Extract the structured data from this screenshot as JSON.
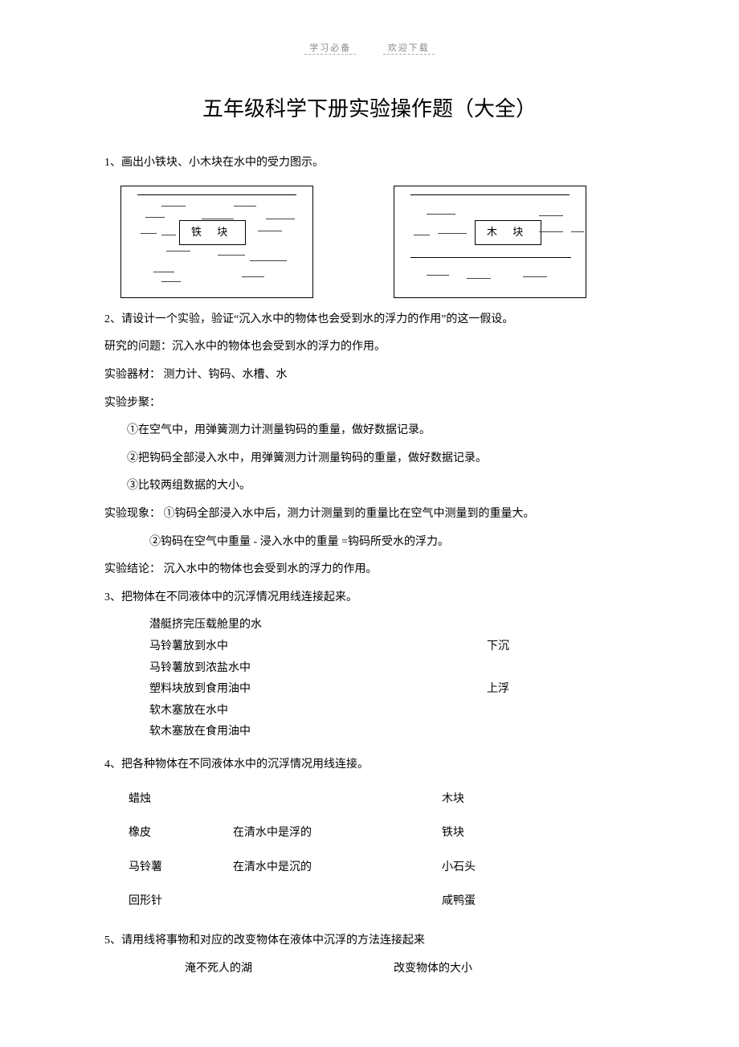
{
  "header": {
    "left": "学习必备",
    "right": "欢迎下载"
  },
  "title": "五年级科学下册实验操作题（大全）",
  "diagram": {
    "label1": "铁  块",
    "label2": "木  块"
  },
  "q1": "1、画出小铁块、小木块在水中的受力图示。",
  "q2": {
    "prompt": "2、请设计一个实验，验证“沉入水中的物体也会受到水的浮力的作用”的这一假设。",
    "problem_label": "研究的问题：",
    "problem": "沉入水中的物体也会受到水的浮力的作用。",
    "apparatus_label": "实验器材：",
    "apparatus": " 测力计、钩码、水槽、水",
    "steps_label": "实验步聚：",
    "steps": [
      "①在空气中，用弹簧测力计测量钩码的重量，做好数据记录。",
      "②把钩码全部浸入水中，用弹簧测力计测量钩码的重量，做好数据记录。",
      "③比较两组数据的大小。"
    ],
    "phenomena_label": "实验现象：",
    "phenomena": [
      " ①钩码全部浸入水中后，测力计测量到的重量比在空气中测量到的重量大。",
      "②钩码在空气中重量   - 浸入水中的重量   =钩码所受水的浮力。"
    ],
    "conclusion_label": "实验结论：",
    "conclusion": " 沉入水中的物体也会受到水的浮力的作用。"
  },
  "q3": {
    "prompt": "3、把物体在不同液体中的沉浮情况用线连接起来。",
    "left": [
      "潜艇挤完压载舱里的水",
      "马铃薯放到水中",
      "马铃薯放到浓盐水中",
      "塑料块放到食用油中",
      "软木塞放在水中",
      "软木塞放在食用油中"
    ],
    "right": [
      "下沉",
      "上浮"
    ]
  },
  "q4": {
    "prompt": "4、把各种物体在不同液体水中的沉浮情况用线连接。",
    "col1": [
      "蜡烛",
      "橡皮",
      "马铃薯",
      "回形针"
    ],
    "col2": [
      "",
      "在清水中是浮的",
      "在清水中是沉的",
      ""
    ],
    "col3": [
      "木块",
      "铁块",
      "小石头",
      "咸鸭蛋"
    ]
  },
  "q5": {
    "prompt": "5、请用线将事物和对应的改变物体在液体中沉浮的方法连接起来",
    "left": "淹不死人的湖",
    "right": "改变物体的大小"
  }
}
